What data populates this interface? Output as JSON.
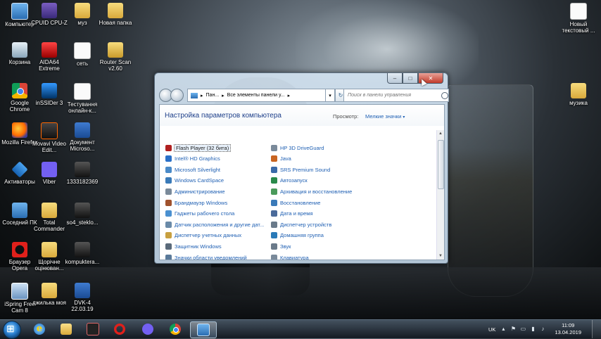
{
  "desktop": {
    "icons": [
      {
        "label": "Компьютер"
      },
      {
        "label": "CPUID CPU-Z"
      },
      {
        "label": "муз"
      },
      {
        "label": "Новая папка"
      },
      {
        "label": "Новый текстовый ..."
      },
      {
        "label": "Корзина"
      },
      {
        "label": "AIDA64 Extreme"
      },
      {
        "label": "сеть"
      },
      {
        "label": "Router Scan v2.60"
      },
      {
        "label": "Google Chrome"
      },
      {
        "label": "inSSIDer 3"
      },
      {
        "label": "Тестування онлайн-к..."
      },
      {
        "label": "музика"
      },
      {
        "label": "Mozilla Firefox"
      },
      {
        "label": "Movavi Video Edit..."
      },
      {
        "label": "Документ Microso..."
      },
      {
        "label": "Активаторы"
      },
      {
        "label": "Viber"
      },
      {
        "label": "1333182369"
      },
      {
        "label": "Соседний ПК"
      },
      {
        "label": "Total Commander"
      },
      {
        "label": "so4_steklo..."
      },
      {
        "label": "Браузер Opera"
      },
      {
        "label": "Щорічне оцінюван..."
      },
      {
        "label": "kompukterа..."
      },
      {
        "label": "iSpring Free Cam 8"
      },
      {
        "label": "джилька моя"
      },
      {
        "label": "DVK-4 22.03.19"
      }
    ]
  },
  "window": {
    "caption": {
      "minimize": "–",
      "maximize": "□",
      "close": "✕"
    },
    "address": {
      "crumb1": "Пан...",
      "sep1": "▸",
      "crumb2": "Все элементы панели у...",
      "sep2": "▸",
      "dropdown": "▾",
      "refresh": "↻"
    },
    "search": {
      "placeholder": "Поиск в панели управления"
    },
    "heading": "Настройка параметров компьютера",
    "view": {
      "label": "Просмотр:",
      "value": "Мелкие значки",
      "arrow": "▾"
    },
    "items_left": [
      {
        "label": "Flash Player (32 бита)",
        "color": "#b02020",
        "selected": true
      },
      {
        "label": "Intel® HD Graphics",
        "color": "#2a70c8"
      },
      {
        "label": "Microsoft Silverlight",
        "color": "#4a8ac8"
      },
      {
        "label": "Windows CardSpace",
        "color": "#3a7ab8"
      },
      {
        "label": "Администрирование",
        "color": "#7a8a9a"
      },
      {
        "label": "Брандмауэр Windows",
        "color": "#a0522d"
      },
      {
        "label": "Гаджеты рабочего стола",
        "color": "#4a90d0"
      },
      {
        "label": "Датчик расположения и другие дат...",
        "color": "#6a8aa8"
      },
      {
        "label": "Диспетчер учетных данных",
        "color": "#c8a040"
      },
      {
        "label": "Защитник Windows",
        "color": "#5a6a7a"
      },
      {
        "label": "Значки области уведомлений",
        "color": "#5a7a9a"
      }
    ],
    "items_right": [
      {
        "label": "HP 3D DriveGuard",
        "color": "#7a8a9a"
      },
      {
        "label": "Java",
        "color": "#c86420"
      },
      {
        "label": "SRS Premium Sound",
        "color": "#3a6aa8"
      },
      {
        "label": "Автозапуск",
        "color": "#2a8a4a"
      },
      {
        "label": "Архивация и восстановление",
        "color": "#4a9a5a"
      },
      {
        "label": "Восстановление",
        "color": "#3a7ab8"
      },
      {
        "label": "Дата и время",
        "color": "#4a6a9a"
      },
      {
        "label": "Диспетчер устройств",
        "color": "#6a7a8a"
      },
      {
        "label": "Домашняя группа",
        "color": "#2a7ab8"
      },
      {
        "label": "Звук",
        "color": "#6a7a8a"
      },
      {
        "label": "Клавиатура",
        "color": "#7a8a9a"
      }
    ]
  },
  "taskbar": {
    "items": [
      "start-orb",
      "internet-explorer",
      "windows-explorer",
      "app",
      "opera",
      "viber",
      "chrome",
      "control-panel"
    ],
    "tray": {
      "lang": "UK",
      "time": "11:09",
      "date": "13.04.2019"
    }
  },
  "colors": {
    "link": "#1e5fb3",
    "heading": "#1e3f8a"
  }
}
